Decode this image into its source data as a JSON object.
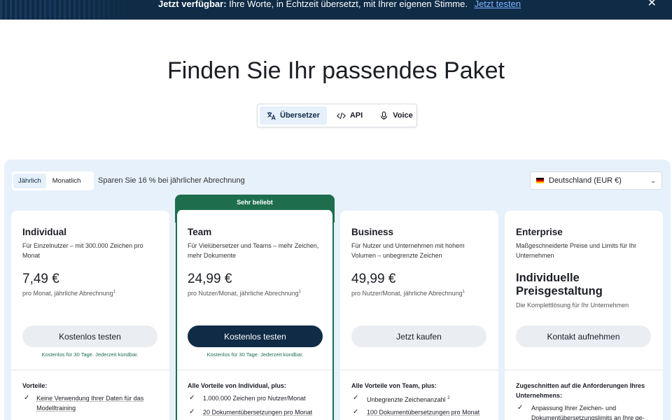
{
  "banner": {
    "bold": "Jetzt verfügbar:",
    "text": "Ihre Worte, in Echtzeit übersetzt, mit Ihrer eigenen Stimme.",
    "link": "Jetzt testen",
    "close_icon": "close-icon"
  },
  "title": "Finden Sie Ihr passendes Paket",
  "tabs": [
    {
      "label": "Übersetzer",
      "icon": "translate-icon",
      "active": true
    },
    {
      "label": "API",
      "icon": "code-icon",
      "active": false
    },
    {
      "label": "Voice",
      "icon": "microphone-icon",
      "active": false
    }
  ],
  "billing": {
    "options": [
      "Jährlich",
      "Monatlich"
    ],
    "selected": "Jährlich",
    "note": "Sparen Sie 16 % bei jährlicher Abrechnung"
  },
  "country": {
    "value": "Deutschland (EUR €)"
  },
  "popular_label": "Sehr beliebt",
  "plans": [
    {
      "name": "Individual",
      "desc": "Für Einzelnutzer – mit 300.000 Zeichen pro Monat",
      "price": "7,49 €",
      "per": "pro Monat, jährliche Abrechnung",
      "sup": "1",
      "button": "Kostenlos testen",
      "trial": "Kostenlos für 30 Tage. Jederzeit kündbar.",
      "features_title": "Vorteile:",
      "features": [
        "Keine Verwendung Ihrer Daten für das Modelltraining"
      ]
    },
    {
      "name": "Team",
      "desc": "Für Vielübersetzer und Teams – mehr Zeichen, mehr Dokumente",
      "price": "24,99 €",
      "per": "pro Nutzer/Monat, jährliche Abrechnung",
      "sup": "1",
      "button": "Kostenlos testen",
      "trial": "Kostenlos für 30 Tage. Jederzeit kündbar.",
      "features_title": "Alle Vorteile von Individual, plus:",
      "features": [
        "1.000.000 Zeichen pro Nutzer/Monat",
        "20 Dokumentübersetzungen pro Monat"
      ]
    },
    {
      "name": "Business",
      "desc": "Für Nutzer und Unternehmen mit hohem Volumen – unbegrenzte Zeichen",
      "price": "49,99 €",
      "per": "pro Nutzer/Monat, jährliche Abrechnung",
      "sup": "1",
      "button": "Jetzt kaufen",
      "features_title": "Alle Vorteile von Team, plus:",
      "features": [
        "Unbegrenzte Zeichenanzahl",
        "100 Dokumentübersetzungen pro Monat"
      ],
      "feature_sup": "2"
    },
    {
      "name": "Enterprise",
      "desc": "Maßgeschneiderte Preise und Limits für Ihr Unternehmen",
      "price": "Individuelle Preisgestaltung",
      "per": "Die Komplettlösung für Ihr Unternehmen",
      "button": "Kontakt aufnehmen",
      "features_title": "Zugeschnitten auf die Anforderungen Ihres Unternehmens:",
      "features": [
        "Anpassung Ihrer Zeichen- und Dokumentübersetzungslimits an Ihre ge-"
      ]
    }
  ]
}
